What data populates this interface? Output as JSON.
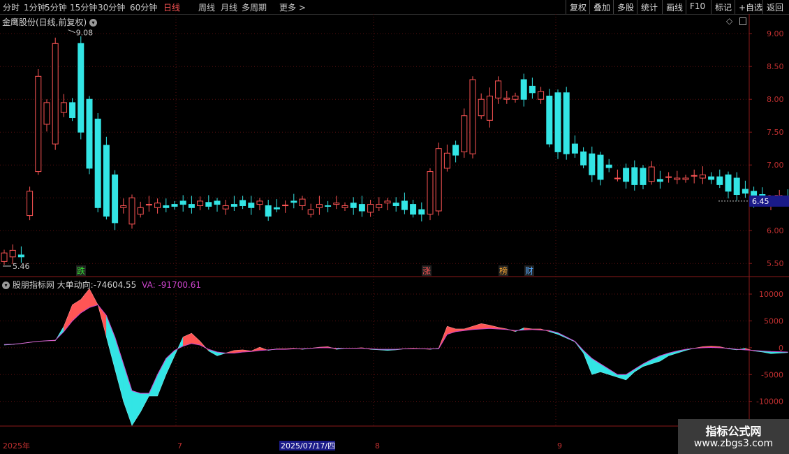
{
  "toolbar": {
    "periods": [
      "分时",
      "1分钟",
      "5分钟",
      "15分钟",
      "30分钟",
      "60分钟",
      "日线",
      "周线",
      "月线",
      "多周期",
      "更多 >"
    ],
    "active_period": "日线",
    "right_buttons": [
      "复权",
      "叠加",
      "多股",
      "统计",
      "画线",
      "F10",
      "标记",
      "+自选",
      "返回"
    ]
  },
  "main_panel": {
    "title": "金鹰股份(日线,前复权)",
    "price_axis_ticks": [
      "9.00",
      "8.50",
      "8.00",
      "7.50",
      "7.00",
      "6.50",
      "6.00",
      "5.50"
    ],
    "current_price_label": "6.45",
    "high_marker": "9.08",
    "low_marker": "5.46",
    "event_tags": [
      {
        "text": "跌",
        "color": "#33dd33"
      },
      {
        "text": "涨",
        "color": "#ff5555"
      },
      {
        "text": "榜",
        "color": "#ffaa33"
      },
      {
        "text": "财",
        "color": "#55aaff"
      }
    ]
  },
  "indicator_panel": {
    "name": "股朋指标网",
    "line1_label": "大单动向:",
    "line1_value": "-74604.55",
    "line2_label": "VA:",
    "line2_value": "-91700.61",
    "axis_ticks": [
      "10000",
      "5000",
      "0",
      "-5000",
      "-10000"
    ]
  },
  "date_axis": {
    "labels": [
      "2025年",
      "7",
      "2025/07/17/四",
      "8",
      "9"
    ]
  },
  "watermark": {
    "title": "指标公式网",
    "url": "www.zbgs3.com"
  },
  "colors": {
    "up": "#ff5555",
    "down": "#33e5e5",
    "axis": "#8b1a1a",
    "ma": "#cc44cc"
  },
  "chart_data": {
    "type": "candlestick",
    "open": [
      5.53,
      5.6,
      5.63,
      6.23,
      6.9,
      7.62,
      7.32,
      7.8,
      7.95,
      8.85,
      8.0,
      7.7,
      7.3,
      6.85,
      6.35,
      6.1,
      6.25,
      6.4,
      6.35,
      6.38,
      6.4,
      6.45,
      6.4,
      6.38,
      6.43,
      6.45,
      6.33,
      6.4,
      6.46,
      6.42,
      6.4,
      6.38,
      6.35,
      6.38,
      6.45,
      6.38,
      6.25,
      6.35,
      6.38,
      6.4,
      6.35,
      6.42,
      6.4,
      6.28,
      6.35,
      6.42,
      6.42,
      6.45,
      6.4,
      6.32,
      6.25,
      6.3,
      6.95,
      7.3,
      7.2,
      7.17,
      7.75,
      7.68,
      8.02,
      8.0,
      8.0,
      8.3,
      8.2,
      8.0,
      8.05,
      8.1,
      8.1,
      7.32,
      7.2,
      7.17,
      7.15,
      7.0,
      6.8,
      6.95,
      6.96,
      6.95,
      6.75,
      6.78,
      6.82,
      6.78,
      6.78,
      6.83,
      6.8,
      6.82,
      6.82,
      6.85,
      6.8,
      6.63,
      6.6,
      6.55,
      6.4,
      6.45,
      6.5
    ],
    "close": [
      5.66,
      5.7,
      5.6,
      6.6,
      8.35,
      7.95,
      8.85,
      7.95,
      7.72,
      7.5,
      6.95,
      6.35,
      6.22,
      6.12,
      6.38,
      6.5,
      6.35,
      6.4,
      6.42,
      6.35,
      6.37,
      6.4,
      6.35,
      6.45,
      6.37,
      6.4,
      6.38,
      6.37,
      6.38,
      6.35,
      6.45,
      6.22,
      6.33,
      6.39,
      6.43,
      6.48,
      6.32,
      6.4,
      6.37,
      6.42,
      6.38,
      6.35,
      6.3,
      6.4,
      6.4,
      6.45,
      6.38,
      6.32,
      6.25,
      6.25,
      6.9,
      7.25,
      7.18,
      7.15,
      7.75,
      8.3,
      8.0,
      8.05,
      8.28,
      8.02,
      8.05,
      8.0,
      8.1,
      8.12,
      7.32,
      7.2,
      7.17,
      7.18,
      7.0,
      6.85,
      6.78,
      6.96,
      6.8,
      6.75,
      6.7,
      6.7,
      6.97,
      6.75,
      6.82,
      6.8,
      6.8,
      6.84,
      6.85,
      6.78,
      6.7,
      6.6,
      6.55,
      6.57,
      6.4,
      6.5,
      6.45,
      6.53,
      6.45
    ],
    "price_range": [
      5.3,
      9.3
    ],
    "indicator": {
      "big_order": [
        500,
        600,
        800,
        1000,
        1200,
        1300,
        1300,
        4000,
        8000,
        9000,
        11000,
        8000,
        2000,
        -4000,
        -10000,
        -14500,
        -12000,
        -9000,
        -9000,
        -5000,
        -1500,
        2000,
        2700,
        1200,
        -600,
        -1500,
        -1000,
        -500,
        -400,
        -600,
        100,
        -500,
        -200,
        -200,
        -100,
        -300,
        -100,
        100,
        200,
        -300,
        -100,
        -100,
        0,
        -300,
        -400,
        -500,
        -400,
        -200,
        -100,
        -200,
        -300,
        -100,
        4000,
        3500,
        3500,
        4000,
        4500,
        4200,
        3800,
        3500,
        3000,
        3700,
        3500,
        3500,
        3000,
        2500,
        1800,
        1100,
        -1000,
        -5000,
        -4500,
        -5000,
        -5500,
        -6000,
        -4500,
        -3500,
        -3000,
        -2500,
        -1500,
        -1000,
        -500,
        -100,
        200,
        300,
        200,
        -200,
        -400,
        -100,
        -600,
        -800,
        -1100,
        -1000,
        -900
      ],
      "va": [
        600,
        650,
        800,
        1000,
        1200,
        1300,
        1400,
        3000,
        5000,
        6500,
        7500,
        8000,
        6000,
        2000,
        -3000,
        -8000,
        -8500,
        -8500,
        -5000,
        -2000,
        -500,
        300,
        800,
        500,
        -300,
        -800,
        -1000,
        -1000,
        -800,
        -700,
        -500,
        -400,
        -300,
        -300,
        -200,
        -200,
        -100,
        0,
        0,
        -100,
        -100,
        -100,
        -100,
        -200,
        -300,
        -300,
        -300,
        -200,
        -200,
        -200,
        -200,
        -200,
        2500,
        3000,
        3200,
        3400,
        3500,
        3600,
        3500,
        3400,
        3200,
        3300,
        3400,
        3300,
        3200,
        2800,
        2000,
        1200,
        -500,
        -2000,
        -3000,
        -4000,
        -5000,
        -5000,
        -4000,
        -3000,
        -2200,
        -1500,
        -1000,
        -600,
        -300,
        -100,
        0,
        50,
        0,
        -100,
        -300,
        -400,
        -500,
        -600,
        -700,
        -750,
        -800
      ],
      "range": [
        -14600,
        13000
      ]
    }
  }
}
